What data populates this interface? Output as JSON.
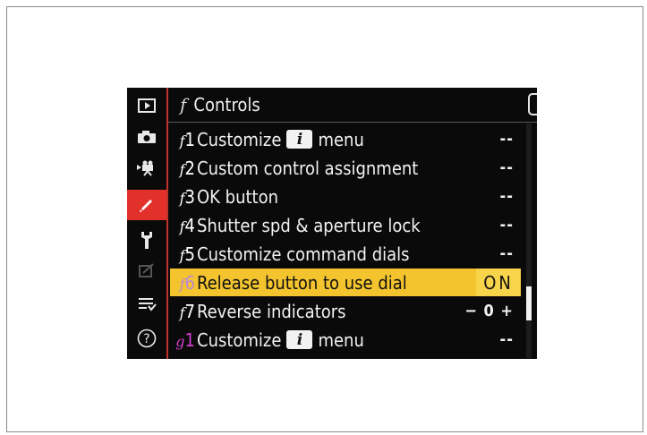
{
  "menu": {
    "section_code": "f",
    "title": "Controls",
    "back_icon": "return-arrow-icon"
  },
  "sidebar": {
    "items": [
      {
        "name": "playback-menu",
        "icon": "playback-icon"
      },
      {
        "name": "photo-shooting-menu",
        "icon": "camera-icon"
      },
      {
        "name": "movie-shooting-menu",
        "icon": "movie-camera-icon"
      },
      {
        "name": "custom-settings-menu",
        "icon": "pencil-icon",
        "active": true
      },
      {
        "name": "setup-menu",
        "icon": "wrench-icon"
      },
      {
        "name": "retouch-menu",
        "icon": "retouch-icon"
      },
      {
        "name": "my-menu",
        "icon": "my-menu-icon"
      },
      {
        "name": "help",
        "icon": "help-icon",
        "label": "?"
      }
    ]
  },
  "rows": [
    {
      "letter": "f",
      "num": "1",
      "label_pre": "Customize",
      "badge": "i",
      "label_post": "menu",
      "value": "--"
    },
    {
      "letter": "f",
      "num": "2",
      "label_pre": "Custom control assignment",
      "value": "--"
    },
    {
      "letter": "f",
      "num": "3",
      "label_pre": "OK button",
      "value": "--"
    },
    {
      "letter": "f",
      "num": "4",
      "label_pre": "Shutter spd & aperture lock",
      "value": "--"
    },
    {
      "letter": "f",
      "num": "5",
      "label_pre": "Customize command dials",
      "value": "--"
    },
    {
      "letter": "f",
      "num": "6",
      "label_pre": "Release button to use dial",
      "value": "ON",
      "selected": true
    },
    {
      "letter": "f",
      "num": "7",
      "label_pre": "Reverse indicators",
      "value": "− 0 +"
    },
    {
      "letter": "g",
      "num": "1",
      "label_pre": "Customize",
      "badge": "i",
      "label_post": "menu",
      "value": "--"
    }
  ],
  "colors": {
    "accent_red": "#e2312b",
    "highlight_yellow": "#f3c42e",
    "g_section_magenta": "#d33fd3",
    "selected_code_lilac": "#b98ad6"
  }
}
